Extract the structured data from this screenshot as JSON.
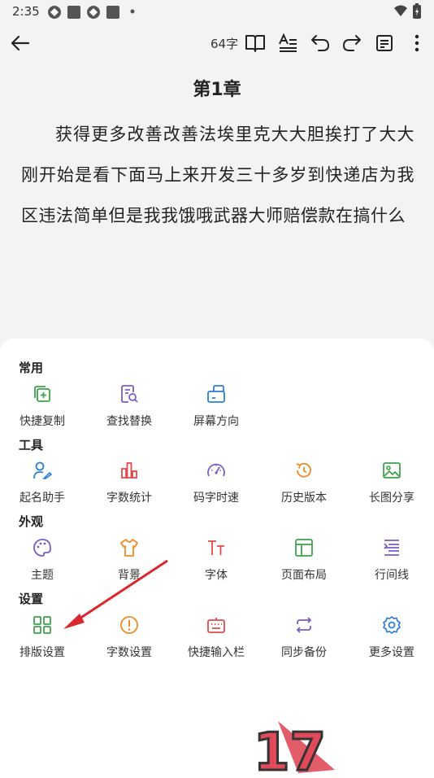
{
  "status_bar": {
    "time": "2:35"
  },
  "toolbar": {
    "word_count": "64字"
  },
  "document": {
    "chapter_title": "第1章",
    "body": "获得更多改善改善法埃里克大大胆挨打了大大刚开始是看下面马上来开发三十多岁到快递店为我区违法简单但是我我饿哦武器大师赔偿款在搞什么"
  },
  "menu": {
    "sections": [
      {
        "title": "常用",
        "items": [
          {
            "label": "快捷复制",
            "icon": "copy-plus-icon",
            "color": "#3fa34d"
          },
          {
            "label": "查找替换",
            "icon": "find-replace-icon",
            "color": "#7a5cc7"
          },
          {
            "label": "屏幕方向",
            "icon": "screen-orientation-icon",
            "color": "#2d7fd3"
          }
        ]
      },
      {
        "title": "工具",
        "items": [
          {
            "label": "起名助手",
            "icon": "naming-assistant-icon",
            "color": "#2d7fd3"
          },
          {
            "label": "字数统计",
            "icon": "word-stats-icon",
            "color": "#e24a4a"
          },
          {
            "label": "码字时速",
            "icon": "typing-speed-icon",
            "color": "#7a5cc7"
          },
          {
            "label": "历史版本",
            "icon": "history-version-icon",
            "color": "#f08a24"
          },
          {
            "label": "长图分享",
            "icon": "long-image-share-icon",
            "color": "#3fa34d"
          }
        ]
      },
      {
        "title": "外观",
        "items": [
          {
            "label": "主题",
            "icon": "theme-palette-icon",
            "color": "#7a5cc7"
          },
          {
            "label": "背景",
            "icon": "background-shirt-icon",
            "color": "#f08a24"
          },
          {
            "label": "字体",
            "icon": "font-icon",
            "color": "#e24a4a"
          },
          {
            "label": "页面布局",
            "icon": "page-layout-icon",
            "color": "#3fa34d"
          },
          {
            "label": "行间线",
            "icon": "line-spacing-icon",
            "color": "#7a5cc7"
          }
        ]
      },
      {
        "title": "设置",
        "items": [
          {
            "label": "排版设置",
            "icon": "layout-settings-icon",
            "color": "#3fa34d"
          },
          {
            "label": "字数设置",
            "icon": "word-count-settings-icon",
            "color": "#f08a24"
          },
          {
            "label": "快捷输入栏",
            "icon": "quick-input-bar-icon",
            "color": "#e24a4a"
          },
          {
            "label": "同步备份",
            "icon": "sync-backup-icon",
            "color": "#7a5cc7"
          },
          {
            "label": "更多设置",
            "icon": "more-settings-gear-icon",
            "color": "#2d7fd3"
          }
        ]
      }
    ]
  },
  "annotation": {
    "arrow_color": "#d9282f"
  },
  "watermark": {
    "text": "17"
  }
}
